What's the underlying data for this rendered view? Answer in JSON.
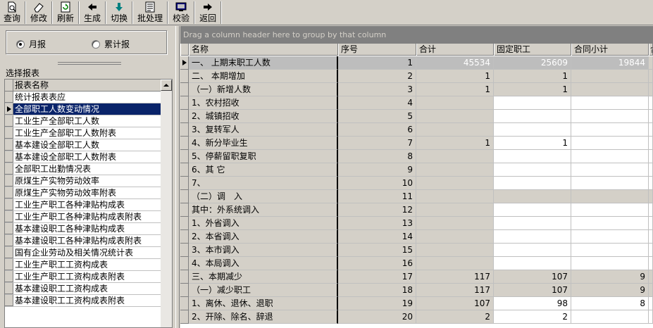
{
  "toolbar": {
    "buttons": [
      {
        "label": "查询",
        "icon": "query-doc-icon"
      },
      {
        "label": "修改",
        "icon": "eraser-icon"
      },
      {
        "label": "刷新",
        "icon": "refresh-icon"
      },
      {
        "label": "生成",
        "icon": "arrow-left-icon"
      },
      {
        "label": "切换",
        "icon": "arrow-down-icon"
      },
      {
        "label": "批处理",
        "icon": "batch-doc-icon"
      },
      {
        "label": "校验",
        "icon": "check-monitor-icon"
      },
      {
        "label": "返回",
        "icon": "arrow-right-icon"
      }
    ]
  },
  "period": {
    "monthly_label": "月报",
    "cumulative_label": "累计报",
    "selected": "monthly"
  },
  "report_list": {
    "section_label": "选择报表",
    "column_header": "报表名称",
    "items": [
      "统计报表表应",
      "全部职工人数变动情况",
      "工业生产全部职工人数",
      "工业生产全部职工人数附表",
      "基本建设全部职工人数",
      "基本建设全部职工人数附表",
      "全部职工出勤情况表",
      "原煤生产实物劳动效率",
      "原煤生产实物劳动效率附表",
      "工业生产职工各种津贴构成表",
      "工业生产职工各种津贴构成表附表",
      "基本建设职工各种津贴构成表",
      "基本建设职工各种津贴构成表附表",
      "国有企业劳动及相关情况统计表",
      "工业生产职工工资构成表",
      "工业生产职工工资构成表附表",
      "基本建设职工工资构成表",
      "基本建设职工工资构成表附表"
    ],
    "selected_index": 1
  },
  "grid": {
    "group_hint": "Drag a column header here to group by that column",
    "headers": [
      "名称",
      "序号",
      "合计",
      "固定职工",
      "合同小计",
      "合"
    ],
    "rows": [
      {
        "name": "一、 上期末职工人数",
        "seq": "1",
        "total": "45534",
        "fixed": "25609",
        "contract": "19844",
        "gray": true
      },
      {
        "name": "二、 本期增加",
        "seq": "2",
        "total": "1",
        "fixed": "1",
        "contract": "",
        "gray": true
      },
      {
        "name": "（一）新增人数",
        "seq": "3",
        "total": "1",
        "fixed": "1",
        "contract": "",
        "gray": true
      },
      {
        "name": "1、农村招收",
        "seq": "4",
        "total": "",
        "fixed": "",
        "contract": "",
        "gray": false
      },
      {
        "name": "2、城镇招收",
        "seq": "5",
        "total": "",
        "fixed": "",
        "contract": "",
        "gray": false
      },
      {
        "name": "3、复转军人",
        "seq": "6",
        "total": "",
        "fixed": "",
        "contract": "",
        "gray": false
      },
      {
        "name": "4、新分毕业生",
        "seq": "7",
        "total": "1",
        "fixed": "1",
        "contract": "",
        "gray": false
      },
      {
        "name": "5、停薪留职复职",
        "seq": "8",
        "total": "",
        "fixed": "",
        "contract": "",
        "gray": false
      },
      {
        "name": "6、其 它",
        "seq": "9",
        "total": "",
        "fixed": "",
        "contract": "",
        "gray": false
      },
      {
        "name": "7、",
        "seq": "10",
        "total": "",
        "fixed": "",
        "contract": "",
        "gray": false
      },
      {
        "name": "（二）调　入",
        "seq": "11",
        "total": "",
        "fixed": "",
        "contract": "",
        "gray": true
      },
      {
        "name": "其中：外系统调入",
        "seq": "12",
        "total": "",
        "fixed": "",
        "contract": "",
        "gray": false
      },
      {
        "name": "1、外省调入",
        "seq": "13",
        "total": "",
        "fixed": "",
        "contract": "",
        "gray": false
      },
      {
        "name": "2、本省调入",
        "seq": "14",
        "total": "",
        "fixed": "",
        "contract": "",
        "gray": false
      },
      {
        "name": "3、本市调入",
        "seq": "15",
        "total": "",
        "fixed": "",
        "contract": "",
        "gray": false
      },
      {
        "name": "4、本局调入",
        "seq": "16",
        "total": "",
        "fixed": "",
        "contract": "",
        "gray": false
      },
      {
        "name": "三、本期减少",
        "seq": "17",
        "total": "117",
        "fixed": "107",
        "contract": "9",
        "gray": true
      },
      {
        "name": "（一）减少职工",
        "seq": "18",
        "total": "117",
        "fixed": "107",
        "contract": "9",
        "gray": true
      },
      {
        "name": "1、离休、退休、退职",
        "seq": "19",
        "total": "107",
        "fixed": "98",
        "contract": "8",
        "gray": false
      },
      {
        "name": "2、开除、除名、辞退",
        "seq": "20",
        "total": "2",
        "fixed": "2",
        "contract": "",
        "gray": false
      }
    ]
  }
}
